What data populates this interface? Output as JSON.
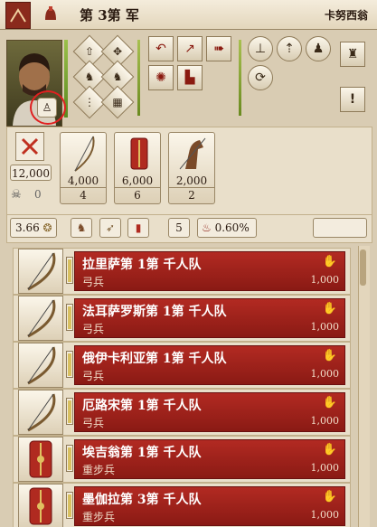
{
  "header": {
    "army_title": "第 3第 军",
    "general_name": "卡努西翁"
  },
  "portrait": {
    "status_icon": "statue-icon"
  },
  "formation_buttons": [
    {
      "icon": "arrow-formation-icon"
    },
    {
      "icon": "spread-formation-icon"
    },
    {
      "icon": "cavalry-left-icon"
    },
    {
      "icon": "cavalry-right-icon"
    },
    {
      "icon": "column-formation-icon"
    },
    {
      "icon": "square-formation-icon"
    },
    {
      "icon": "guard-formation-icon"
    },
    {
      "icon": "close-formation-icon"
    }
  ],
  "order_buttons": [
    {
      "icon": "return-icon"
    },
    {
      "icon": "split-icon"
    },
    {
      "icon": "run-icon"
    },
    {
      "icon": "starburst-icon"
    },
    {
      "icon": "fortify-icon"
    }
  ],
  "command_buttons": [
    {
      "icon": "halt-icon"
    },
    {
      "icon": "charge-icon"
    },
    {
      "icon": "group-icon"
    },
    {
      "icon": "cycle-icon"
    },
    {
      "icon": "elephant-icon"
    },
    {
      "icon": "alert-icon"
    }
  ],
  "summary": {
    "total_men": "12,000",
    "deaths": "0",
    "cards": [
      {
        "icon": "bow-icon",
        "men": "4,000",
        "units": "4"
      },
      {
        "icon": "shield-icon",
        "men": "6,000",
        "units": "6"
      },
      {
        "icon": "horse-icon",
        "men": "2,000",
        "units": "2"
      }
    ]
  },
  "stats": {
    "supply": "3.66",
    "unit_count": "5",
    "percent": "0.60%"
  },
  "units": [
    {
      "name": "拉里萨第 1第 千人队",
      "type": "弓兵",
      "men": "1,000",
      "icon": "bow-icon",
      "fill": 0.95
    },
    {
      "name": "法耳萨罗斯第 1第 千人队",
      "type": "弓兵",
      "men": "1,000",
      "icon": "bow-icon",
      "fill": 0.95
    },
    {
      "name": "俄伊卡利亚第 1第 千人队",
      "type": "弓兵",
      "men": "1,000",
      "icon": "bow-icon",
      "fill": 0.95
    },
    {
      "name": "厄路宋第 1第 千人队",
      "type": "弓兵",
      "men": "1,000",
      "icon": "bow-icon",
      "fill": 0.95
    },
    {
      "name": "埃吉翁第 1第 千人队",
      "type": "重步兵",
      "men": "1,000",
      "icon": "shield-icon",
      "fill": 0.95
    },
    {
      "name": "墨伽拉第 3第 千人队",
      "type": "重步兵",
      "men": "1,000",
      "icon": "shield-icon",
      "fill": 0.95
    }
  ]
}
